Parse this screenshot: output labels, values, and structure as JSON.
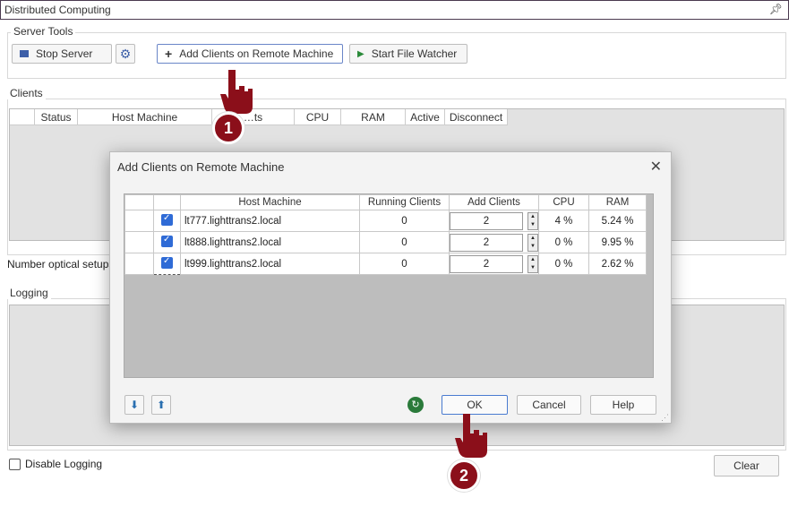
{
  "window": {
    "title": "Distributed Computing",
    "pin_icon": "pin-icon"
  },
  "server_tools": {
    "label": "Server Tools",
    "stop_server": "Stop Server",
    "add_clients": "Add Clients on Remote Machine",
    "start_file_watcher": "Start File Watcher"
  },
  "clients": {
    "label": "Clients",
    "columns": [
      "Status",
      "Host Machine",
      "…ts",
      "CPU",
      "RAM",
      "Active",
      "Disconnect"
    ],
    "number_optical_setups_label": "Number optical setups"
  },
  "logging": {
    "label": "Logging",
    "disable_logging": "Disable Logging",
    "clear": "Clear"
  },
  "dialog": {
    "title": "Add Clients on Remote Machine",
    "columns": [
      "Host Machine",
      "Running Clients",
      "Add Clients",
      "CPU",
      "RAM"
    ],
    "rows": [
      {
        "host": "lt777.lighttrans2.local",
        "running": "0",
        "add": "2",
        "cpu": "4 %",
        "ram": "5.24 %"
      },
      {
        "host": "lt888.lighttrans2.local",
        "running": "0",
        "add": "2",
        "cpu": "0 %",
        "ram": "9.95 %"
      },
      {
        "host": "lt999.lighttrans2.local",
        "running": "0",
        "add": "2",
        "cpu": "0 %",
        "ram": "2.62 %"
      }
    ],
    "ok": "OK",
    "cancel": "Cancel",
    "help": "Help"
  },
  "annotations": {
    "step1": "1",
    "step2": "2",
    "accent": "#8b0f1a"
  }
}
